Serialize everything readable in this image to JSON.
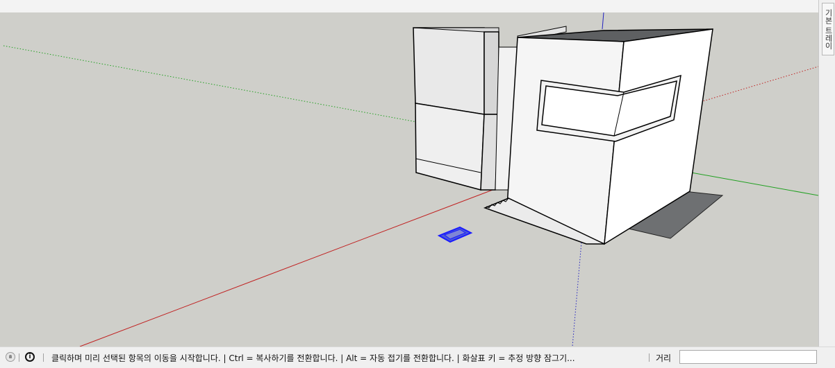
{
  "tray": {
    "label": "기본 트레이"
  },
  "status": {
    "message": "클릭하며 미리 선택된 항목의 이동을 시작합니다. | Ctrl = 복사하기를 전환합니다. | Alt = 자동 접기를 전환합니다. | 화살표 키 = 추정 방향 잠그기...",
    "info_glyph": "i"
  },
  "measurements": {
    "label": "거리",
    "value": ""
  },
  "icons": {
    "geolocation": "geolocation-icon",
    "info": "info-icon"
  },
  "colors": {
    "viewport_bg": "#cfcfca",
    "red_axis": "#c02020",
    "green_axis": "#20a020",
    "blue_axis": "#2020c0",
    "selection": "#1a1aff",
    "shadow": "#6e7072"
  }
}
